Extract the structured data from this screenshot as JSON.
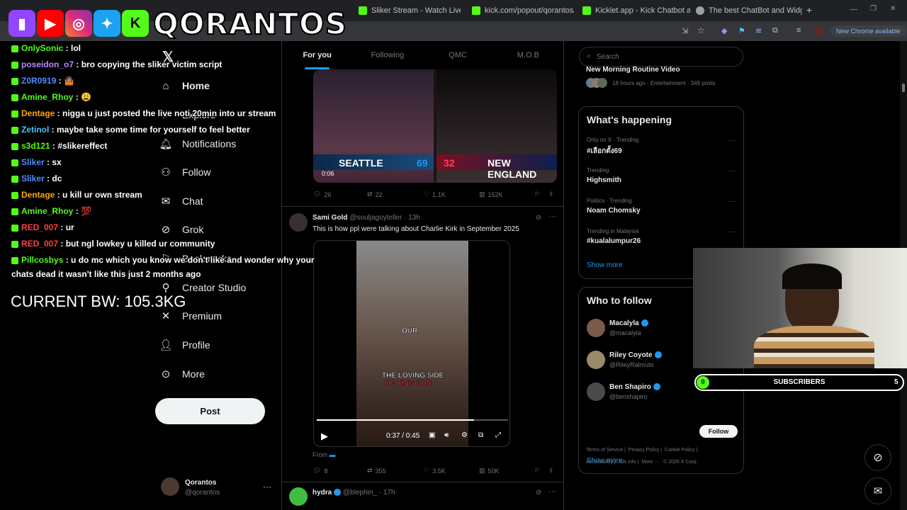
{
  "browser": {
    "tabs": [
      {
        "title": "Sliker Stream - Watch Live on K",
        "color": "#53fc18"
      },
      {
        "title": "kick.com/popout/qorantos/cha",
        "color": "#53fc18"
      },
      {
        "title": "Kicklet.app - Kick Chatbot and",
        "color": "#53fc18"
      },
      {
        "title": "The best ChatBot and Widgets",
        "color": "#9aa0a6"
      }
    ],
    "new_tab": "+",
    "profile_chip": "New Chrome available"
  },
  "overlay": {
    "logo_text": "QORANTOS",
    "bodyweight": "CURRENT BW: 105.3KG",
    "subscriber_bar": {
      "left_count": "0",
      "label": "SUBSCRIBERS",
      "right_count": "5"
    }
  },
  "chat": [
    {
      "user": "OnlySonic",
      "color": "#53fc18",
      "msg": "lol"
    },
    {
      "user": "poseidon_o7",
      "color": "#b58bff",
      "msg": "bro copying the sliker victim script"
    },
    {
      "user": "Z0R0919",
      "color": "#4f8cff",
      "msg": "🤷🏽"
    },
    {
      "user": "Amine_Rhoy",
      "color": "#53fc18",
      "msg": "😩"
    },
    {
      "user": "Dentage",
      "color": "#ffa500",
      "msg": "nigga u just posted the live noti 20min into ur stream"
    },
    {
      "user": "Zetinol",
      "color": "#4fc3f7",
      "msg": "maybe take some time for yourself to feel better"
    },
    {
      "user": "s3d121",
      "color": "#53fc18",
      "msg": "#slikereffect"
    },
    {
      "user": "Sliker",
      "color": "#4f8cff",
      "msg": "sx"
    },
    {
      "user": "Sliker",
      "color": "#4f8cff",
      "msg": "dc"
    },
    {
      "user": "Dentage",
      "color": "#ffa500",
      "msg": "u kill ur own stream"
    },
    {
      "user": "Amine_Rhoy",
      "color": "#53fc18",
      "msg": "💯"
    },
    {
      "user": "RED_007",
      "color": "#ff4040",
      "msg": "ur"
    },
    {
      "user": "RED_007",
      "color": "#ff4040",
      "msg": "but ngl lowkey u killed ur community"
    },
    {
      "user": "Pillcosbys",
      "color": "#53fc18",
      "msg": "u do mc which you know we don't like and wonder why your"
    },
    {
      "user": "",
      "color": "#ffffff",
      "msg": "chats dead it wasn't like this just 2 months ago"
    }
  ],
  "nav": {
    "items": [
      {
        "label": "Home",
        "icon": "home-icon"
      },
      {
        "label": "Explore",
        "icon": "search-icon"
      },
      {
        "label": "Notifications",
        "icon": "bell-icon"
      },
      {
        "label": "Follow",
        "icon": "person-add-icon"
      },
      {
        "label": "Chat",
        "icon": "mail-icon"
      },
      {
        "label": "Grok",
        "icon": "grok-icon"
      },
      {
        "label": "Bookmarks",
        "icon": "bookmark-icon"
      },
      {
        "label": "Creator Studio",
        "icon": "creator-icon"
      },
      {
        "label": "Premium",
        "icon": "x-icon"
      },
      {
        "label": "Profile",
        "icon": "person-icon"
      },
      {
        "label": "More",
        "icon": "more-icon"
      }
    ],
    "post_label": "Post",
    "account": {
      "name": "Qorantos",
      "handle": "@qorantos"
    }
  },
  "feed": {
    "tabs": [
      "For you",
      "Following",
      "QMC",
      "M.O.B"
    ],
    "post1": {
      "left_team": "SEATTLE",
      "left_score": "69",
      "right_team": "NEW ENGLAND",
      "right_score": "32",
      "time": "0:06",
      "replies": "26",
      "reposts": "22",
      "likes": "1.1K",
      "views": "152K"
    },
    "post2": {
      "name": "Sami Gold",
      "handle": "@souljagoyteller",
      "age": "· 13h",
      "text": "This is how ppl were talking about Charlie Kirk in September 2025",
      "caption_top": "OUR",
      "caption_bottom1": "THE LOVING SIDE",
      "caption_bottom2": "OF KING VON",
      "timecode": "0:37 / 0:45",
      "from": "From",
      "replies": "8",
      "reposts": "355",
      "likes": "3.5K",
      "views": "50K"
    },
    "post3": {
      "name": "hydra",
      "handle": "@blephin_",
      "age": "· 17h"
    }
  },
  "sidebar": {
    "search_placeholder": "Search",
    "top_item": {
      "title": "New Morning Routine Video",
      "meta": "18 hours ago · Entertainment · 349 posts"
    },
    "happening_title": "What's happening",
    "trends": [
      {
        "meta": "Only on X · Trending",
        "name": "#เลือกตั้ง69"
      },
      {
        "meta": "Trending",
        "name": "Highsmith"
      },
      {
        "meta": "Politics · Trending",
        "name": "Noam Chomsky"
      },
      {
        "meta": "Trending in Malaysia",
        "name": "#kualalumpur26"
      }
    ],
    "show_more": "Show more",
    "who_title": "Who to follow",
    "who": [
      {
        "name": "Macalyla",
        "handle": "@macalyla"
      },
      {
        "name": "Riley Coyote",
        "handle": "@RileyRalmuto"
      },
      {
        "name": "Ben Shapiro",
        "handle": "@benshapiro"
      }
    ],
    "follow_label": "Follow",
    "show_more2": "Show more",
    "footer": [
      "Terms of Service",
      "Privacy Policy",
      "Cookie Policy",
      "Accessibility",
      "Ads info",
      "More ···",
      "© 2026 X Corp."
    ]
  },
  "colors": {
    "accent": "#1d9bf0",
    "kick": "#53fc18"
  }
}
